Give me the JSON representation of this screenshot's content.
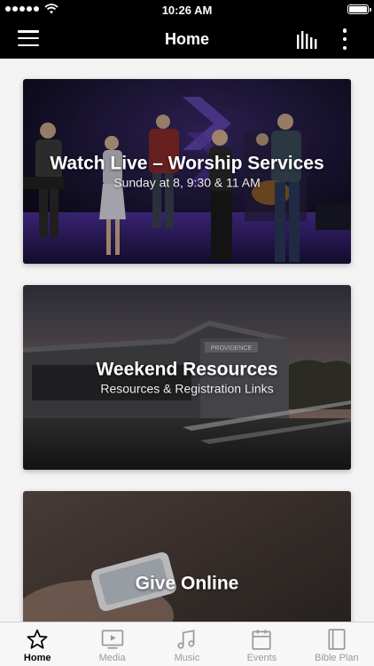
{
  "status_bar": {
    "time": "10:26 AM"
  },
  "nav": {
    "title": "Home"
  },
  "cards": [
    {
      "title": "Watch Live – Worship Services",
      "subtitle": "Sunday at 8, 9:30 & 11 AM"
    },
    {
      "title": "Weekend Resources",
      "subtitle": "Resources & Registration Links"
    },
    {
      "title": "Give Online",
      "subtitle": ""
    }
  ],
  "building_sign": "PROVIDENCE",
  "tabs": [
    {
      "label": "Home",
      "icon": "star-icon",
      "active": true
    },
    {
      "label": "Media",
      "icon": "play-screen-icon",
      "active": false
    },
    {
      "label": "Music",
      "icon": "music-note-icon",
      "active": false
    },
    {
      "label": "Events",
      "icon": "calendar-icon",
      "active": false
    },
    {
      "label": "Bible Plan",
      "icon": "book-icon",
      "active": false
    }
  ],
  "colors": {
    "nav_bg": "#000000",
    "tab_active": "#000000",
    "tab_inactive": "#9a9a9a",
    "stage_purple": "#5a3aa0"
  }
}
